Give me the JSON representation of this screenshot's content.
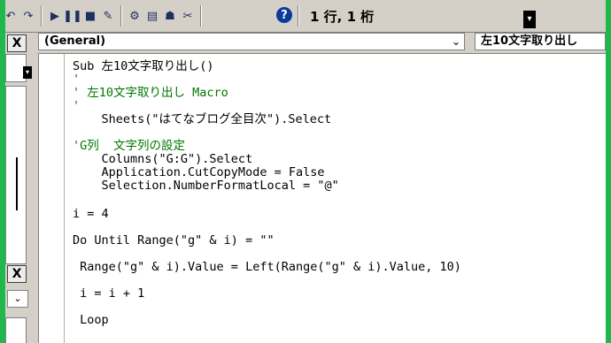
{
  "toolbar": {
    "cursor_position": "1 行, 1 桁",
    "icons": [
      "undo-icon",
      "redo-icon",
      "run-icon",
      "pause-icon",
      "stop-icon",
      "design-mode-icon",
      "project-explorer-icon",
      "properties-icon",
      "object-browser-icon",
      "toolbox-icon",
      "help-icon"
    ]
  },
  "left_panel": {
    "close_label": "X",
    "close_label_2": "X"
  },
  "object_combo": {
    "value": "(General)"
  },
  "procedure_combo": {
    "value": "左10文字取り出し"
  },
  "code": {
    "line1": "Sub 左10文字取り出し()",
    "line2": "'",
    "line3": "' 左10文字取り出し Macro",
    "line4": "'",
    "line5": "    Sheets(\"はてなブログ全目次\").Select",
    "line6": "'G列  文字列の設定",
    "line7": "    Columns(\"G:G\").Select",
    "line8": "    Application.CutCopyMode = False",
    "line9": "    Selection.NumberFormatLocal = \"@\"",
    "line10": "i = 4",
    "line11": "Do Until Range(\"g\" & i) = \"\"",
    "line12": " Range(\"g\" & i).Value = Left(Range(\"g\" & i).Value, 10)",
    "line13": " i = i + 1",
    "line14": " Loop"
  },
  "colors": {
    "background_border": "#1fb84a",
    "comment": "#007800",
    "chrome": "#d4d0c8"
  }
}
